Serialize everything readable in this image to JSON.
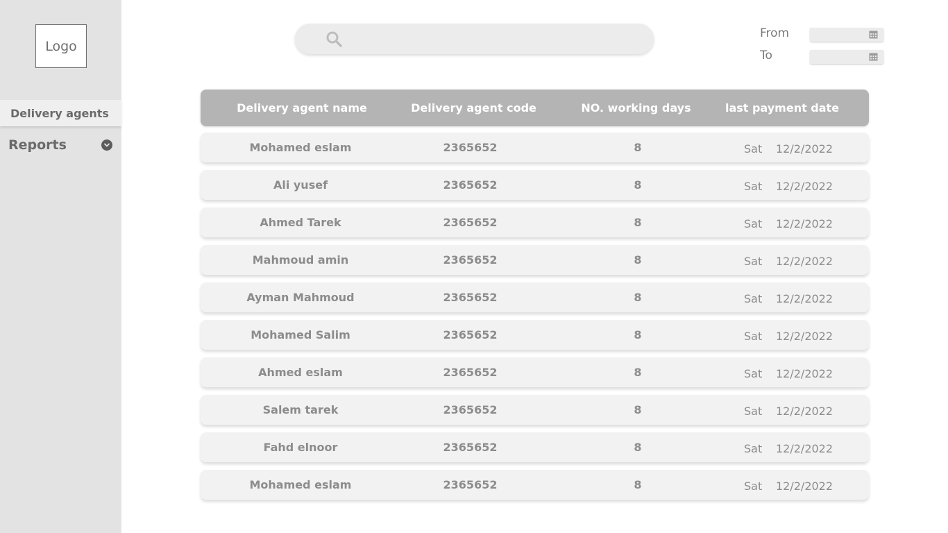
{
  "sidebar": {
    "logo": "Logo",
    "items": [
      {
        "label": "Delivery agents"
      },
      {
        "label": "Reports"
      }
    ]
  },
  "search": {
    "placeholder": "",
    "value": ""
  },
  "date_filter": {
    "from_label": "From",
    "to_label": "To",
    "from_value": "",
    "to_value": ""
  },
  "table": {
    "headers": [
      "Delivery agent name",
      "Delivery agent code",
      "NO. working days",
      "last payment date"
    ],
    "rows": [
      {
        "name": "Mohamed eslam",
        "code": "2365652",
        "days": "8",
        "day": "Sat",
        "date": "12/2/2022"
      },
      {
        "name": "Ali yusef",
        "code": "2365652",
        "days": "8",
        "day": "Sat",
        "date": "12/2/2022"
      },
      {
        "name": "Ahmed Tarek",
        "code": "2365652",
        "days": "8",
        "day": "Sat",
        "date": "12/2/2022"
      },
      {
        "name": "Mahmoud amin",
        "code": "2365652",
        "days": "8",
        "day": "Sat",
        "date": "12/2/2022"
      },
      {
        "name": "Ayman Mahmoud",
        "code": "2365652",
        "days": "8",
        "day": "Sat",
        "date": "12/2/2022"
      },
      {
        "name": "Mohamed Salim",
        "code": "2365652",
        "days": "8",
        "day": "Sat",
        "date": "12/2/2022"
      },
      {
        "name": "Ahmed eslam",
        "code": "2365652",
        "days": "8",
        "day": "Sat",
        "date": "12/2/2022"
      },
      {
        "name": "Salem tarek",
        "code": "2365652",
        "days": "8",
        "day": "Sat",
        "date": "12/2/2022"
      },
      {
        "name": "Fahd elnoor",
        "code": "2365652",
        "days": "8",
        "day": "Sat",
        "date": "12/2/2022"
      },
      {
        "name": "Mohamed eslam",
        "code": "2365652",
        "days": "8",
        "day": "Sat",
        "date": "12/2/2022"
      }
    ]
  },
  "icons": {
    "search": "search-icon",
    "calendar": "calendar-icon",
    "chevron": "chevron-down-icon"
  },
  "colors": {
    "sidebar_bg": "#e3e3e3",
    "header_bg": "#b4b4b4",
    "row_bg": "#f2f2f2"
  }
}
